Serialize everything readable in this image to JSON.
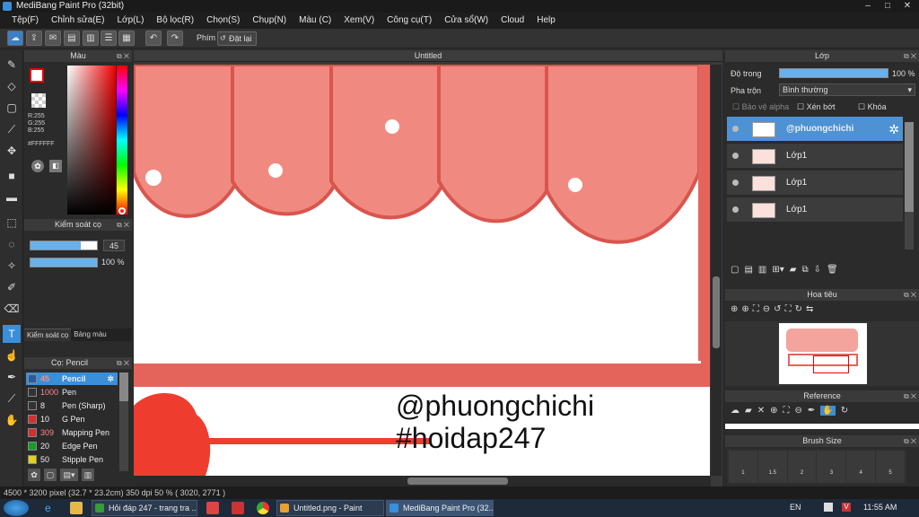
{
  "window": {
    "title": "MediBang Paint Pro (32bit)"
  },
  "menu": [
    "Tệp(F)",
    "Chỉnh sửa(E)",
    "Lớp(L)",
    "Bộ lọc(R)",
    "Chọn(S)",
    "Chụp(N)",
    "Màu (C)",
    "Xem(V)",
    "Công cụ(T)",
    "Cửa sổ(W)",
    "Cloud",
    "Help"
  ],
  "toolbar": {
    "shortcut_label": "Phím",
    "reset_label": "Đặt lại"
  },
  "color_panel": {
    "title": "Màu",
    "r": "R:255",
    "g": "G:255",
    "b": "B:255",
    "hex": "#FFFFFF"
  },
  "brush_control": {
    "title": "Kiểm soát cọ",
    "size": "45",
    "opacity": "100 %",
    "tab1": "Kiểm soát cọ",
    "tab2": "Bảng màu"
  },
  "brush_list": {
    "title": "Cọ: Pencil",
    "items": [
      {
        "size": "45",
        "name": "Pencil",
        "color": "#2a5aa0"
      },
      {
        "size": "1000",
        "name": "Pen",
        "color": "#333333"
      },
      {
        "size": "8",
        "name": "Pen (Sharp)",
        "color": "#333333"
      },
      {
        "size": "10",
        "name": "G Pen",
        "color": "#d03030"
      },
      {
        "size": "309",
        "name": "Mapping Pen",
        "color": "#d03030"
      },
      {
        "size": "20",
        "name": "Edge Pen",
        "color": "#1a9a2a"
      },
      {
        "size": "50",
        "name": "Stipple Pen",
        "color": "#e0d020"
      }
    ]
  },
  "canvas": {
    "tab": "Untitled",
    "watermark_line1": "@phuongchichi",
    "watermark_line2": "#hoidap247"
  },
  "layers": {
    "title": "Lớp",
    "opacity_label": "Độ trong",
    "opacity_value": "100 %",
    "opacity_fraction": 1.0,
    "blend_label": "Pha trộn",
    "blend_value": "Bình thường",
    "protect_alpha": "Bảo vệ alpha",
    "clipping": "Xén bớt",
    "lock": "Khóa",
    "rows": [
      {
        "name": "@phuongchichi",
        "selected": true
      },
      {
        "name": "Lớp1",
        "selected": false
      },
      {
        "name": "Lớp1",
        "selected": false
      },
      {
        "name": "Lớp1",
        "selected": false
      }
    ]
  },
  "navigator": {
    "title": "Hoa tiêu"
  },
  "reference": {
    "title": "Reference"
  },
  "brush_size": {
    "title": "Brush Size",
    "sizes": [
      "1",
      "1.5",
      "2",
      "3",
      "4",
      "5"
    ]
  },
  "status": {
    "text": "4500 * 3200 pixel  (32.7 * 23.2cm)  350 dpi  50 %  ( 3020, 2771 )"
  },
  "taskbar": {
    "tasks": [
      "Hỏi đáp 247 - trang tra ...",
      "Untitled.png - Paint",
      "MediBang Paint Pro (32..."
    ],
    "lang": "EN",
    "time": "11:55 AM"
  }
}
